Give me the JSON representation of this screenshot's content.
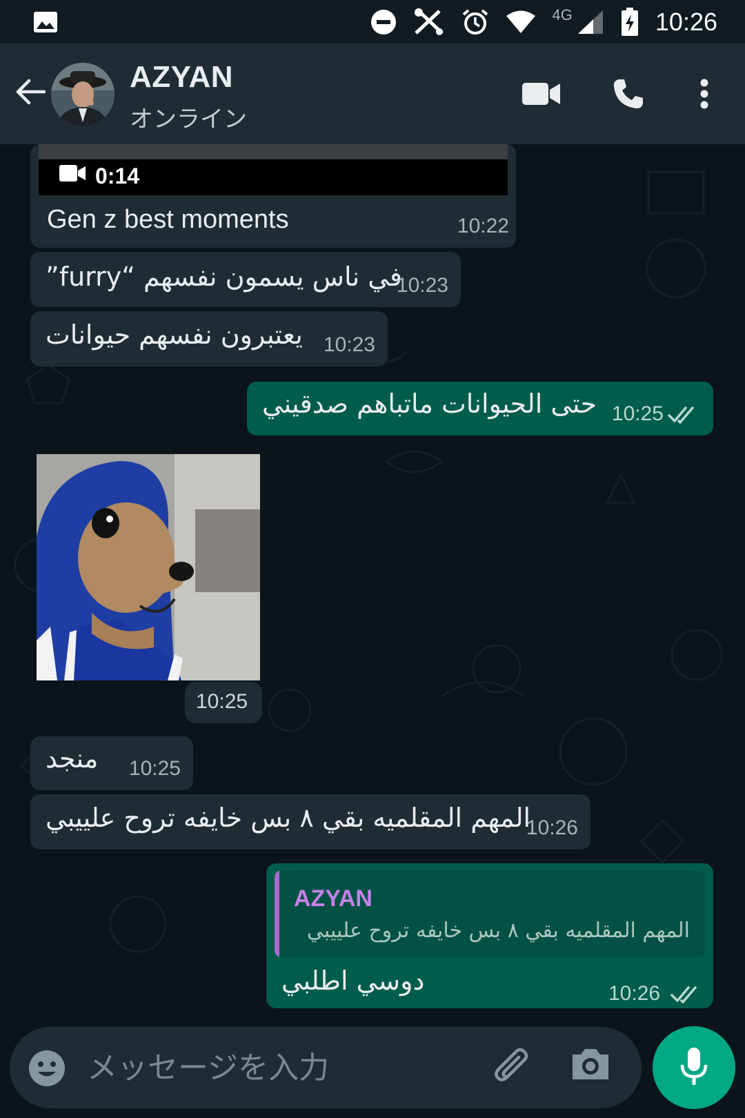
{
  "status_bar": {
    "time": "10:26",
    "network_label": "4G",
    "icons": [
      "gallery-icon",
      "do-not-disturb-icon",
      "tools-icon",
      "alarm-icon",
      "wifi-icon",
      "signal-icon",
      "battery-charging-icon"
    ]
  },
  "header": {
    "contact_name": "AZYAN",
    "contact_status": "オンライン",
    "icons": [
      "back-arrow-icon",
      "video-call-icon",
      "voice-call-icon",
      "more-vert-icon"
    ]
  },
  "messages": [
    {
      "direction": "in",
      "type": "video",
      "duration": "0:14",
      "caption": "Gen z best moments",
      "time": "10:22"
    },
    {
      "direction": "in",
      "type": "text",
      "text": "في ناس يسمون نفسهم “furry”",
      "time": "10:23"
    },
    {
      "direction": "in",
      "type": "text",
      "text": "يعتبرون نفسهم حيوانات",
      "time": "10:23"
    },
    {
      "direction": "out",
      "type": "text",
      "text": "حتى الحيوانات ماتباهم صدقيني",
      "time": "10:25",
      "read": true
    },
    {
      "direction": "in",
      "type": "sticker",
      "description": "dog in blue hoodie",
      "time": "10:25"
    },
    {
      "direction": "in",
      "type": "text",
      "text": "منجد",
      "time": "10:25"
    },
    {
      "direction": "in",
      "type": "text",
      "text": "المهم المقلميه بقي ٨ بس خايفه تروح علييبي",
      "time": "10:26"
    },
    {
      "direction": "out",
      "type": "reply",
      "quoted_name": "AZYAN",
      "quoted_text": "المهم المقلميه بقي ٨ بس خايفه تروح علييبي",
      "text": "دوسي اطلبي",
      "time": "10:26",
      "read": true
    }
  ],
  "composer": {
    "placeholder": "メッセージを入力",
    "value": "",
    "icons": [
      "emoji-icon",
      "attach-icon",
      "camera-icon",
      "mic-icon"
    ]
  },
  "colors": {
    "background": "#0b141a",
    "header": "#1f2c34",
    "incoming_bubble": "#1f2c34",
    "outgoing_bubble": "#005c4b",
    "accent": "#00a884",
    "quote_name": "#c482e6"
  }
}
